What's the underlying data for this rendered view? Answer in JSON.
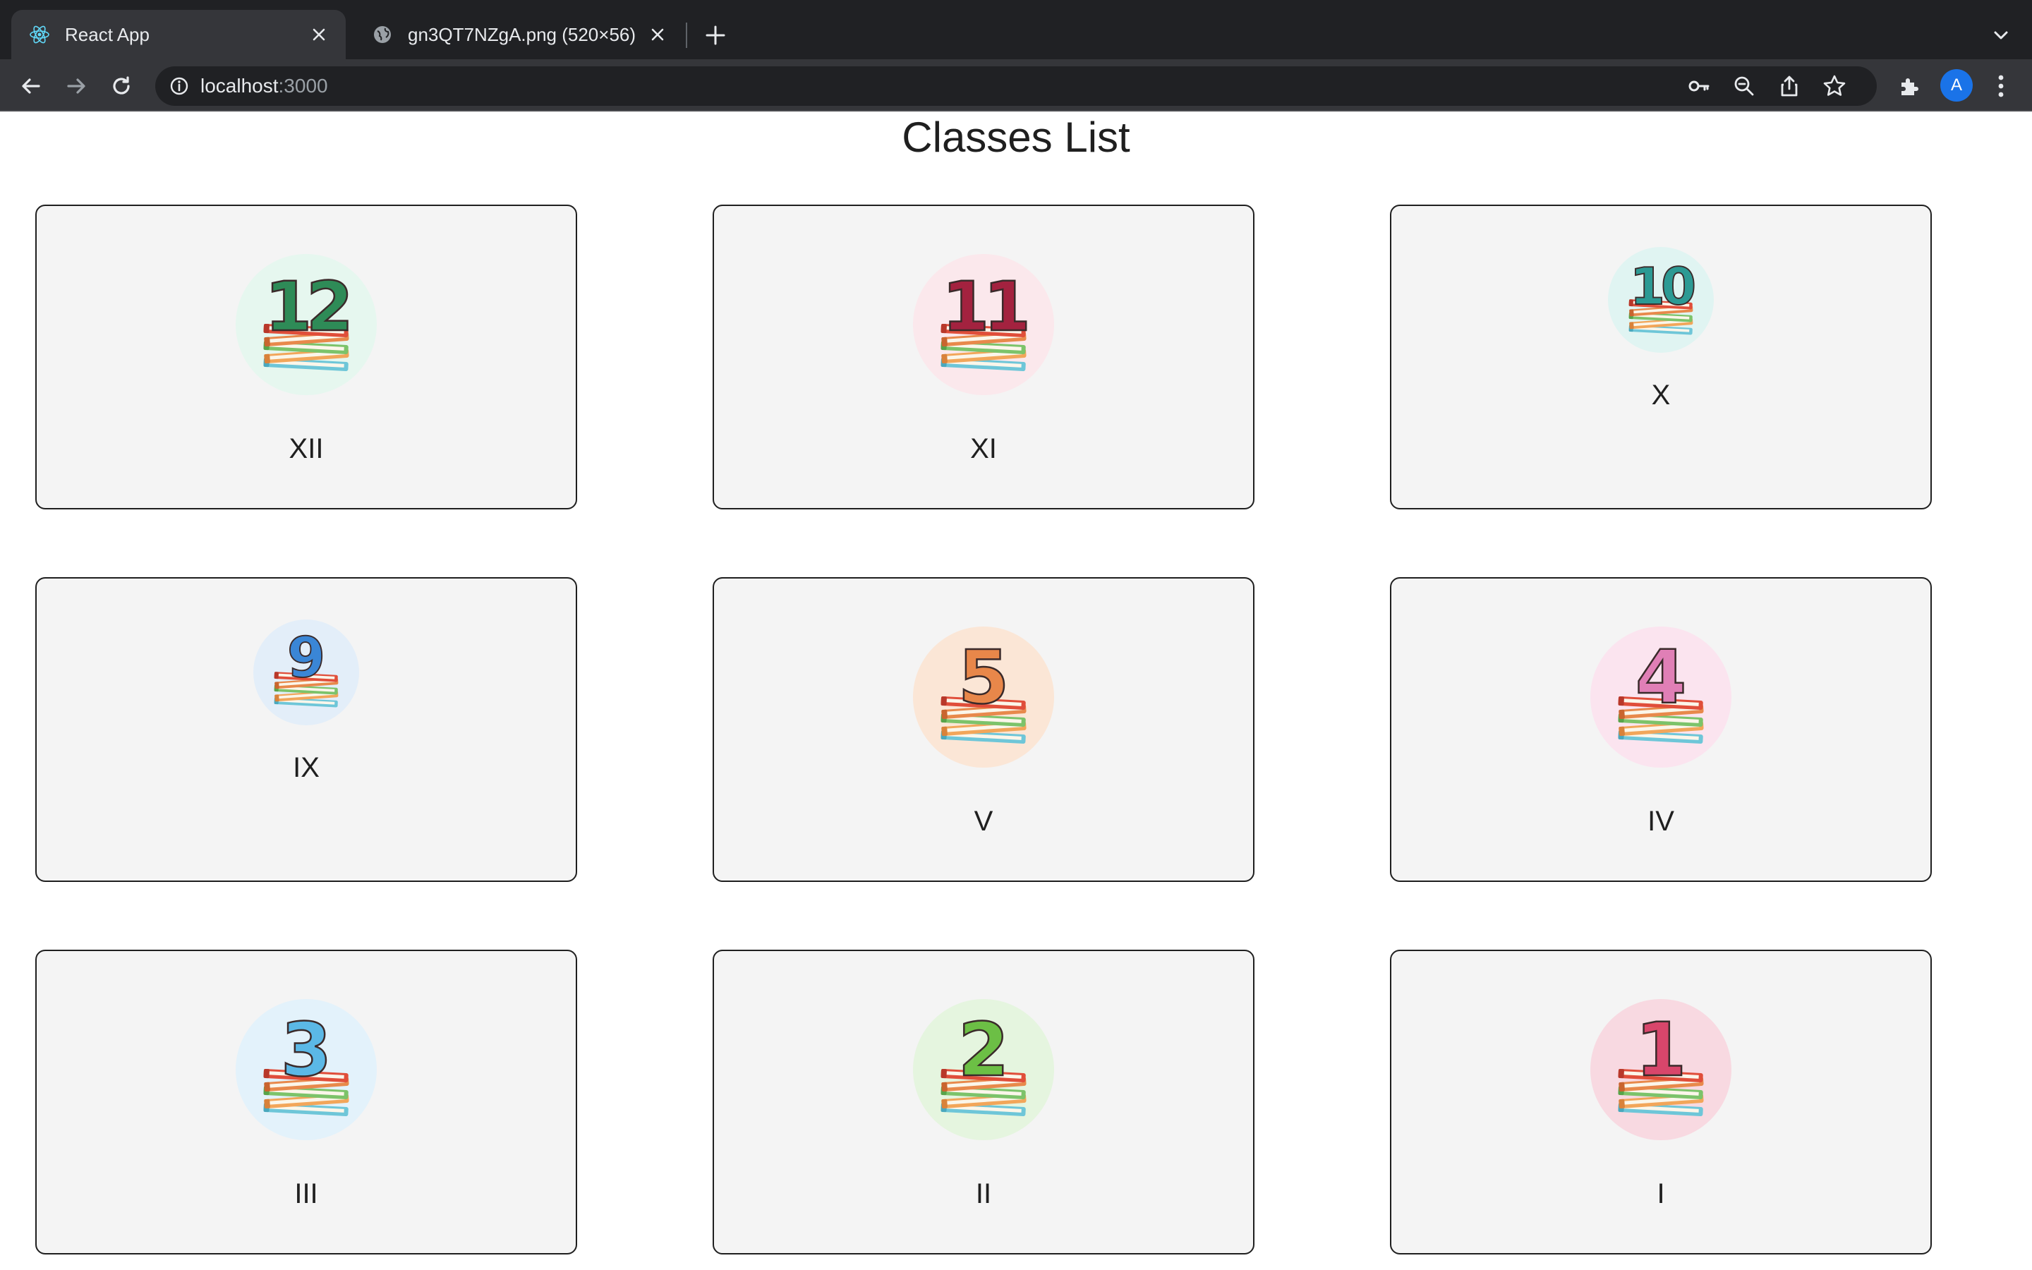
{
  "browser": {
    "tabs": [
      {
        "title": "React App",
        "active": true,
        "icon": "react-icon"
      },
      {
        "title": "gn3QT7NZgA.png (520×56)",
        "active": false,
        "icon": "globe-icon"
      }
    ],
    "address": {
      "host": "localhost",
      "port": ":3000"
    },
    "avatar_letter": "A"
  },
  "page": {
    "title": "Classes List"
  },
  "classes": [
    {
      "number": "12",
      "label": "XII",
      "circle": "#e6f7ef",
      "digit": "#2e8b57",
      "size": "large"
    },
    {
      "number": "11",
      "label": "XI",
      "circle": "#fbe8ec",
      "digit": "#a3223f",
      "size": "large"
    },
    {
      "number": "10",
      "label": "X",
      "circle": "#e0f4f2",
      "digit": "#2c9a94",
      "size": "small"
    },
    {
      "number": "9",
      "label": "IX",
      "circle": "#e3eef9",
      "digit": "#3a86d6",
      "size": "small"
    },
    {
      "number": "5",
      "label": "V",
      "circle": "#fbe6d6",
      "digit": "#e8874a",
      "size": "large"
    },
    {
      "number": "4",
      "label": "IV",
      "circle": "#fbe4ef",
      "digit": "#e07fb6",
      "size": "large"
    },
    {
      "number": "3",
      "label": "III",
      "circle": "#e3f2fb",
      "digit": "#5bb8e6",
      "size": "large"
    },
    {
      "number": "2",
      "label": "II",
      "circle": "#e5f5df",
      "digit": "#6cbf45",
      "size": "large"
    },
    {
      "number": "1",
      "label": "I",
      "circle": "#f8d9e1",
      "digit": "#d8466b",
      "size": "large"
    }
  ],
  "colors": {
    "tabbar": "#202124",
    "toolbar": "#35363a",
    "card_bg": "#f4f4f4",
    "card_border": "#1f1f1f"
  }
}
